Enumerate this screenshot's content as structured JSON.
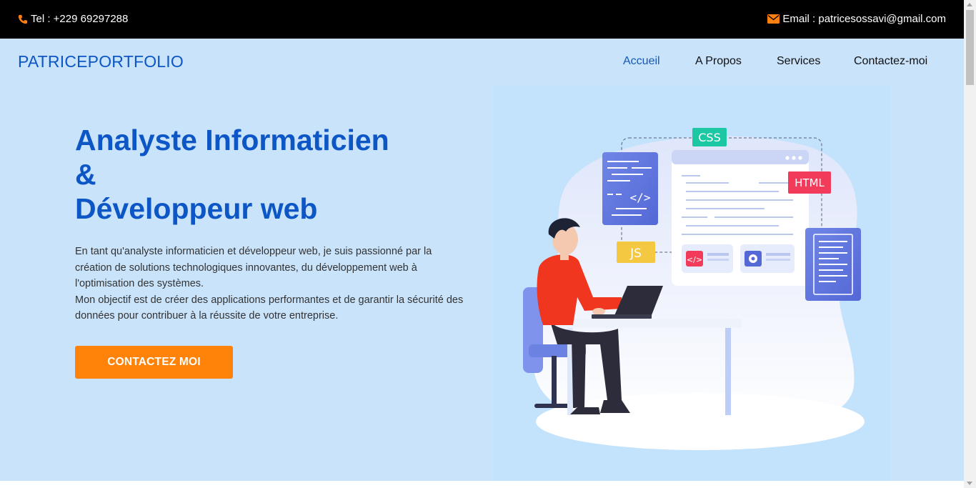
{
  "topbar": {
    "tel": "Tel : +229 69297288",
    "email": "Email : patricesossavi@gmail.com",
    "phone_icon": "phone-icon",
    "mail_icon": "envelope-icon",
    "icon_color": "#ff7f11"
  },
  "header": {
    "brand": "PATRICEPORTFOLIO",
    "nav": [
      {
        "label": "Accueil",
        "active": true
      },
      {
        "label": "A Propos",
        "active": false
      },
      {
        "label": "Services",
        "active": false
      },
      {
        "label": "Contactez-moi",
        "active": false
      }
    ]
  },
  "hero": {
    "title_lines": [
      "Analyste Informaticien",
      "&",
      "Développeur web"
    ],
    "description_lines": [
      "En tant qu'analyste informaticien et développeur web, je suis passionné par la",
      "création de solutions technologiques innovantes, du développement web à",
      "l'optimisation des systèmes.",
      "Mon objectif est de créer des applications performantes et de garantir la sécurité des",
      "données pour contribuer à la réussite de votre entreprise."
    ],
    "cta_label": "CONTACTEZ MOI"
  },
  "illustration": {
    "tags": {
      "css": "CSS",
      "html": "HTML",
      "js": "JS"
    },
    "colors": {
      "brand": "#0d56c6",
      "accent": "#ff8309",
      "bg": "#c9e3fb"
    }
  }
}
